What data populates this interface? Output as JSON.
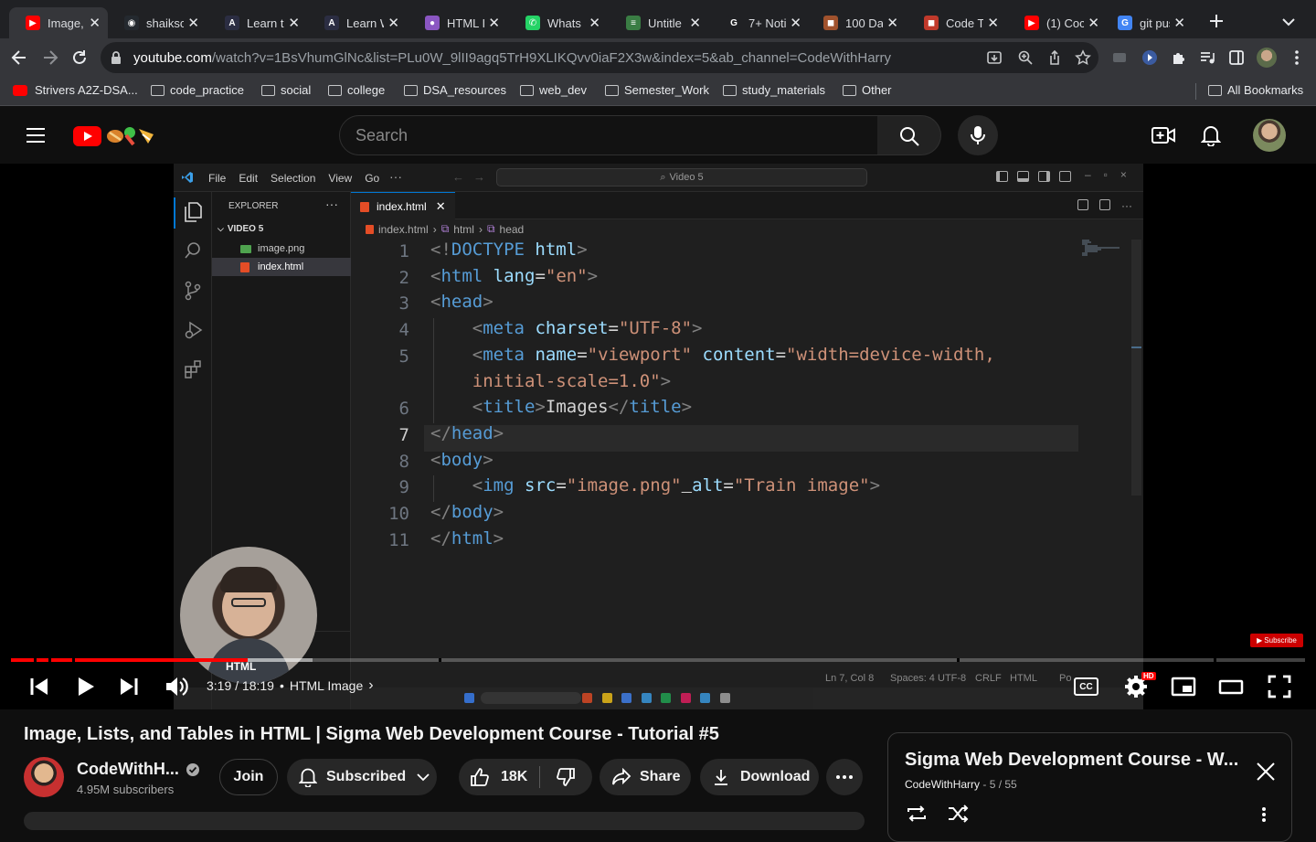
{
  "browser": {
    "tabs": [
      {
        "label": "Image,",
        "fav_color": "#ff0000",
        "fav_char": "▶"
      },
      {
        "label": "shaiksc",
        "fav_color": "#24292f",
        "fav_char": "◉"
      },
      {
        "label": "Learn t",
        "fav_color": "#2b2d42",
        "fav_char": "A"
      },
      {
        "label": "Learn W",
        "fav_color": "#2b2d42",
        "fav_char": "A"
      },
      {
        "label": "HTML I",
        "fav_color": "#8a56c2",
        "fav_char": "●"
      },
      {
        "label": "Whats",
        "fav_color": "#25d366",
        "fav_char": "✆"
      },
      {
        "label": "Untitle",
        "fav_color": "#3a7d44",
        "fav_char": "≡"
      },
      {
        "label": "7+ Noti",
        "fav_color": "#202124",
        "fav_char": "G"
      },
      {
        "label": "100 Da",
        "fav_color": "#a0522d",
        "fav_char": "◼"
      },
      {
        "label": "Code T",
        "fav_color": "#c0392b",
        "fav_char": "◼"
      },
      {
        "label": "(1) Coc",
        "fav_color": "#ff0000",
        "fav_char": "▶"
      },
      {
        "label": "git pus",
        "fav_color": "#4285f4",
        "fav_char": "G"
      }
    ],
    "url_host": "youtube.com",
    "url_path": "/watch?v=1BsVhumGlNc&list=PLu0W_9lII9agq5TrH9XLIKQvv0iaF2X3w&index=5&ab_channel=CodeWithHarry",
    "bookmarks": [
      "Strivers A2Z-DSA...",
      "code_practice",
      "social",
      "college",
      "DSA_resources",
      "web_dev",
      "Semester_Work",
      "study_materials",
      "Other"
    ],
    "all_bookmarks": "All Bookmarks"
  },
  "youtube": {
    "search_placeholder": "Search",
    "video_title": "Image, Lists, and Tables in HTML | Sigma Web Development Course - Tutorial #5",
    "channel_name": "CodeWithH...",
    "subscribers": "4.95M subscribers",
    "join": "Join",
    "subscribed": "Subscribed",
    "likes": "18K",
    "share": "Share",
    "download": "Download",
    "time": "3:19 / 18:19",
    "chapter": "HTML Image",
    "progress_played": 0.183,
    "hd_badge": "HD",
    "subscribe_badge": "Subscribe",
    "playlist_title": "Sigma Web Development Course - W...",
    "playlist_channel": "CodeWithHarry",
    "playlist_position": "5 / 55"
  },
  "vscode": {
    "menu": [
      "File",
      "Edit",
      "Selection",
      "View",
      "Go"
    ],
    "search": "Video 5",
    "explorer_title": "EXPLORER",
    "folder": "VIDEO 5",
    "files": [
      "image.png",
      "index.html"
    ],
    "tab": "index.html",
    "breadcrumb": [
      "index.html",
      "html",
      "head"
    ],
    "line_numbers": [
      "1",
      "2",
      "3",
      "4",
      "5",
      "",
      "6",
      "7",
      "8",
      "9",
      "10",
      "11"
    ],
    "status": {
      "position": "Ln 7, Col 8",
      "spaces": "Spaces: 4",
      "encoding": "UTF-8",
      "eol": "CRLF",
      "lang": "HTML",
      "port": "Po"
    }
  },
  "code_lines": [
    [
      [
        "pn",
        "<!"
      ],
      [
        "tg",
        "DOCTYPE"
      ],
      [
        "tx",
        " "
      ],
      [
        "at",
        "html"
      ],
      [
        "pn",
        ">"
      ]
    ],
    [
      [
        "pn",
        "<"
      ],
      [
        "tg",
        "html"
      ],
      [
        "tx",
        " "
      ],
      [
        "at",
        "lang"
      ],
      [
        "tx",
        "="
      ],
      [
        "st",
        "\"en\""
      ],
      [
        "pn",
        ">"
      ]
    ],
    [
      [
        "pn",
        "<"
      ],
      [
        "tg",
        "head"
      ],
      [
        "pn",
        ">"
      ]
    ],
    [
      [
        "tx",
        "    "
      ],
      [
        "pn",
        "<"
      ],
      [
        "tg",
        "meta"
      ],
      [
        "tx",
        " "
      ],
      [
        "at",
        "charset"
      ],
      [
        "tx",
        "="
      ],
      [
        "st",
        "\"UTF-8\""
      ],
      [
        "pn",
        ">"
      ]
    ],
    [
      [
        "tx",
        "    "
      ],
      [
        "pn",
        "<"
      ],
      [
        "tg",
        "meta"
      ],
      [
        "tx",
        " "
      ],
      [
        "at",
        "name"
      ],
      [
        "tx",
        "="
      ],
      [
        "st",
        "\"viewport\""
      ],
      [
        "tx",
        " "
      ],
      [
        "at",
        "content"
      ],
      [
        "tx",
        "="
      ],
      [
        "st",
        "\"width=device-width,"
      ]
    ],
    [
      [
        "tx",
        "    "
      ],
      [
        "st",
        "initial-scale=1.0\""
      ],
      [
        "pn",
        ">"
      ]
    ],
    [
      [
        "tx",
        "    "
      ],
      [
        "pn",
        "<"
      ],
      [
        "tg",
        "title"
      ],
      [
        "pn",
        ">"
      ],
      [
        "tx",
        "Images"
      ],
      [
        "pn",
        "</"
      ],
      [
        "tg",
        "title"
      ],
      [
        "pn",
        ">"
      ]
    ],
    [
      [
        "pn",
        "</"
      ],
      [
        "tg",
        "head"
      ],
      [
        "pn",
        ">"
      ]
    ],
    [
      [
        "pn",
        "<"
      ],
      [
        "tg",
        "body"
      ],
      [
        "pn",
        ">"
      ]
    ],
    [
      [
        "tx",
        "    "
      ],
      [
        "pn",
        "<"
      ],
      [
        "tg",
        "img"
      ],
      [
        "tx",
        " "
      ],
      [
        "at",
        "src"
      ],
      [
        "tx",
        "="
      ],
      [
        "st",
        "\"image.png\""
      ],
      [
        "tx",
        " "
      ],
      [
        "at",
        "alt"
      ],
      [
        "tx",
        "="
      ],
      [
        "st",
        "\"Train image\""
      ],
      [
        "pn",
        ">"
      ]
    ],
    [
      [
        "pn",
        "</"
      ],
      [
        "tg",
        "body"
      ],
      [
        "pn",
        ">"
      ]
    ],
    [
      [
        "pn",
        "</"
      ],
      [
        "tg",
        "html"
      ],
      [
        "pn",
        ">"
      ]
    ]
  ]
}
